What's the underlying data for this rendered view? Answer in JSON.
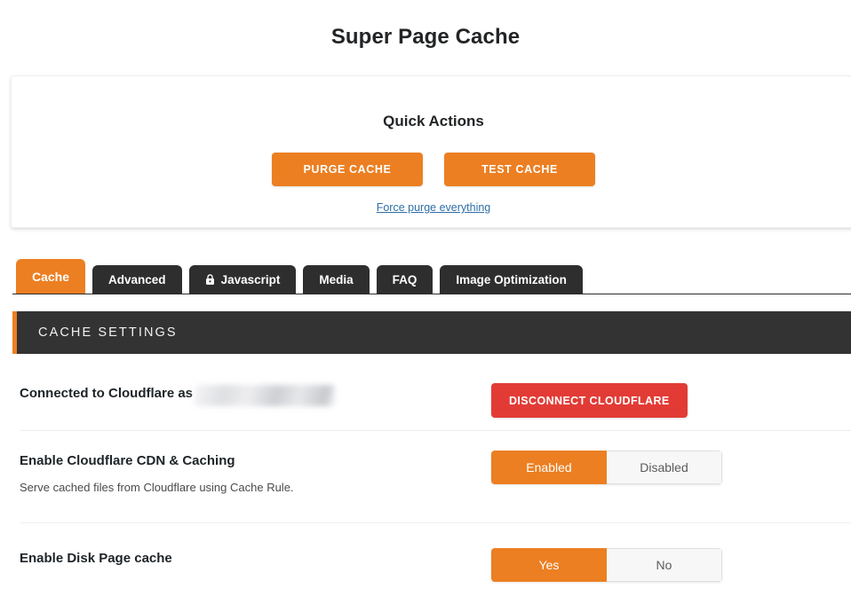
{
  "page": {
    "title": "Super Page Cache"
  },
  "quick_actions": {
    "heading": "Quick Actions",
    "purge_button": "PURGE CACHE",
    "test_button": "TEST CACHE",
    "force_link": "Force purge everything"
  },
  "tabs": [
    {
      "label": "Cache",
      "active": true,
      "icon": ""
    },
    {
      "label": "Advanced",
      "active": false,
      "icon": ""
    },
    {
      "label": "Javascript",
      "active": false,
      "icon": "lock-icon"
    },
    {
      "label": "Media",
      "active": false,
      "icon": ""
    },
    {
      "label": "FAQ",
      "active": false,
      "icon": ""
    },
    {
      "label": "Image Optimization",
      "active": false,
      "icon": ""
    }
  ],
  "section": {
    "title": "CACHE SETTINGS"
  },
  "rows": {
    "connected": {
      "label": "Connected to Cloudflare as",
      "redacted_value": "",
      "button": "DISCONNECT CLOUDFLARE"
    },
    "cdn": {
      "title": "Enable Cloudflare CDN & Caching",
      "description": "Serve cached files from Cloudflare using Cache Rule.",
      "option_on": "Enabled",
      "option_off": "Disabled",
      "selected": "Enabled"
    },
    "disk": {
      "title": "Enable Disk Page cache",
      "description": "",
      "option_on": "Yes",
      "option_off": "No",
      "selected": "Yes"
    }
  },
  "colors": {
    "accent_orange": "#ec7f22",
    "danger_red": "#e23b36",
    "dark_bar": "#333333",
    "tab_dark": "#2e2e2e",
    "link_blue": "#2f6fa7"
  }
}
